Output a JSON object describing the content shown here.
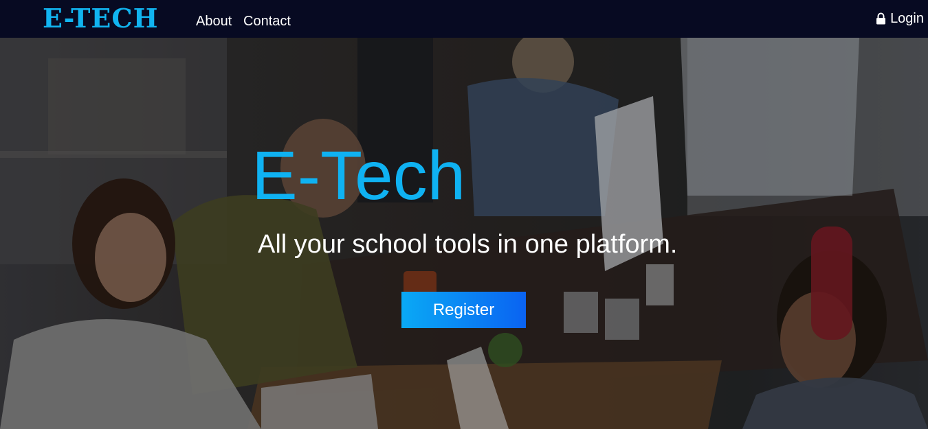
{
  "navbar": {
    "brand": "E-TECH",
    "links": [
      {
        "label": "About"
      },
      {
        "label": "Contact"
      }
    ],
    "login_label": "Login",
    "login_icon": "lock-icon"
  },
  "hero": {
    "title": "E-Tech",
    "subtitle": "All your school tools in one platform.",
    "register_label": "Register",
    "background": "office-coworking-photo"
  },
  "colors": {
    "navbar_bg": "#070a22",
    "brand": "#11b4f0",
    "title": "#0fb2f2",
    "button_start": "#0aa9f5",
    "button_end": "#0a63f2",
    "text": "#ffffff"
  }
}
